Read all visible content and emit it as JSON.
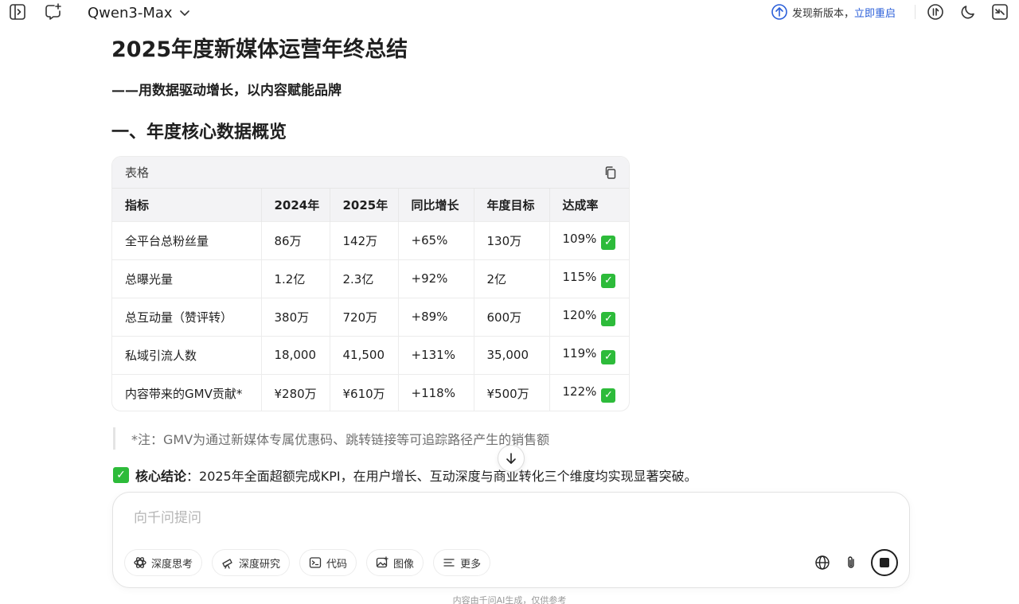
{
  "header": {
    "model_name": "Qwen3-Max",
    "update_notice": "发现新版本，",
    "update_action": "立即重启"
  },
  "document": {
    "title": "2025年度新媒体运营年终总结",
    "subtitle": "——用数据驱动增长，以内容赋能品牌",
    "section_heading": "一、年度核心数据概览",
    "table_card_label": "表格",
    "table": {
      "headers": [
        "指标",
        "2024年",
        "2025年",
        "同比增长",
        "年度目标",
        "达成率"
      ],
      "rows": [
        [
          "全平台总粉丝量",
          "86万",
          "142万",
          "+65%",
          "130万",
          "109%"
        ],
        [
          "总曝光量",
          "1.2亿",
          "2.3亿",
          "+92%",
          "2亿",
          "115%"
        ],
        [
          "总互动量（赞评转）",
          "380万",
          "720万",
          "+89%",
          "600万",
          "120%"
        ],
        [
          "私域引流人数",
          "18,000",
          "41,500",
          "+131%",
          "35,000",
          "119%"
        ],
        [
          "内容带来的GMV贡献*",
          "¥280万",
          "¥610万",
          "+118%",
          "¥500万",
          "122%"
        ]
      ],
      "check_mark": "✓"
    },
    "footnote": "*注：GMV为通过新媒体专属优惠码、跳转链接等可追踪路径产生的销售额",
    "conclusion_label": "核心结论",
    "conclusion_text": "：2025年全面超额完成KPI，在用户增长、互动深度与商业转化三个维度均实现显著突破。"
  },
  "composer": {
    "placeholder": "向千问提问",
    "chips": [
      "深度思考",
      "深度研究",
      "代码",
      "图像",
      "更多"
    ]
  },
  "footer": {
    "disclaimer": "内容由千问AI生成，仅供参考"
  },
  "colors": {
    "accent_link": "#2b5fd9",
    "check_green": "#2dbb3a"
  }
}
